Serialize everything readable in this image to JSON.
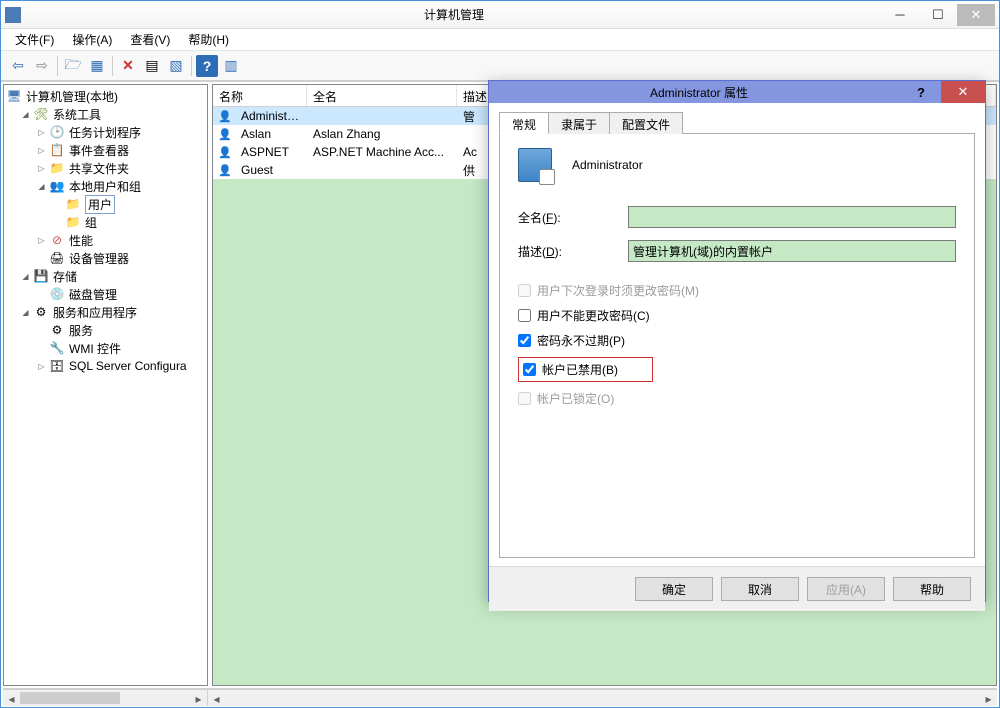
{
  "window": {
    "title": "计算机管理",
    "menus": [
      "文件(F)",
      "操作(A)",
      "查看(V)",
      "帮助(H)"
    ]
  },
  "tree": {
    "root": "计算机管理(本地)",
    "systemTools": "系统工具",
    "taskScheduler": "任务计划程序",
    "eventViewer": "事件查看器",
    "sharedFolders": "共享文件夹",
    "localUsersGroups": "本地用户和组",
    "users": "用户",
    "groups": "组",
    "performance": "性能",
    "deviceManager": "设备管理器",
    "storage": "存储",
    "diskManagement": "磁盘管理",
    "servicesApps": "服务和应用程序",
    "services": "服务",
    "wmiControl": "WMI 控件",
    "sqlConfig": "SQL Server Configura"
  },
  "list": {
    "columns": {
      "name": "名称",
      "fullname": "全名",
      "description": "描述"
    },
    "rows": [
      {
        "name": "Administrat...",
        "fullname": "",
        "description": "管"
      },
      {
        "name": "Aslan",
        "fullname": "Aslan Zhang",
        "description": ""
      },
      {
        "name": "ASPNET",
        "fullname": "ASP.NET Machine Acc...",
        "description": "Ac"
      },
      {
        "name": "Guest",
        "fullname": "",
        "description": "供"
      }
    ]
  },
  "dialog": {
    "title": "Administrator 属性",
    "tabs": {
      "general": "常规",
      "memberOf": "隶属于",
      "profile": "配置文件"
    },
    "username": "Administrator",
    "fullnameLabel": "全名(F):",
    "fullnameValue": "",
    "descriptionLabel": "描述(D):",
    "descriptionValue": "管理计算机(域)的内置帐户",
    "checks": {
      "mustChange": "用户下次登录时须更改密码(M)",
      "cannotChange": "用户不能更改密码(C)",
      "neverExpires": "密码永不过期(P)",
      "disabled": "帐户已禁用(B)",
      "locked": "帐户已锁定(O)"
    },
    "buttons": {
      "ok": "确定",
      "cancel": "取消",
      "apply": "应用(A)",
      "help": "帮助"
    }
  }
}
